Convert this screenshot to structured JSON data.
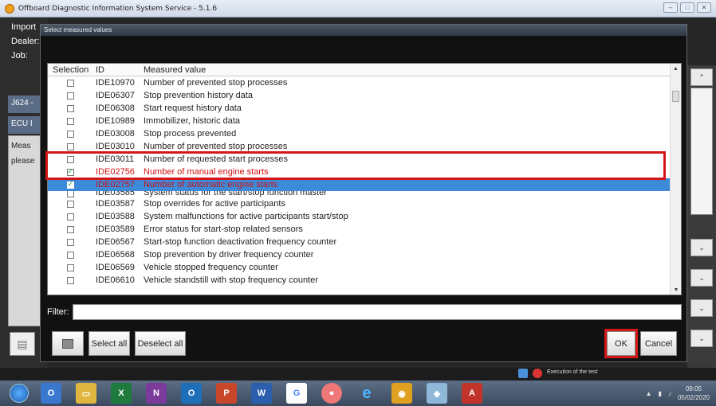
{
  "window": {
    "title": "Offboard Diagnostic Information System Service - 5.1.6"
  },
  "background": {
    "labels": [
      "Import",
      "Dealer:",
      "Job:"
    ],
    "tabs": [
      "J624 -",
      "ECU I"
    ],
    "text": [
      "Meas",
      "please"
    ],
    "status_text": "Execution of the test"
  },
  "dialog": {
    "title": "Select measured values",
    "columns": {
      "selection": "Selection",
      "id": "ID",
      "measured_value": "Measured value"
    },
    "rows": [
      {
        "id": "IDE10970",
        "value": "Number of prevented stop processes",
        "checked": false
      },
      {
        "id": "IDE06307",
        "value": "Stop prevention history data",
        "checked": false
      },
      {
        "id": "IDE06308",
        "value": "Start request history data",
        "checked": false
      },
      {
        "id": "IDE10989",
        "value": "Immobilizer, historic data",
        "checked": false
      },
      {
        "id": "IDE03008",
        "value": "Stop process prevented",
        "checked": false
      },
      {
        "id": "IDE03010",
        "value": "Number of prevented stop processes",
        "checked": false
      },
      {
        "id": "IDE03011",
        "value": "Number of requested start processes",
        "checked": false
      },
      {
        "id": "IDE02756",
        "value": "Number of manual engine starts",
        "checked": true
      },
      {
        "id": "IDE02757",
        "value": "Number of automatic engine starts",
        "checked": true
      },
      {
        "id": "IDE03585",
        "value": "System status for the start/stop function master",
        "checked": false
      },
      {
        "id": "IDE03587",
        "value": "Stop overrides for active participants",
        "checked": false
      },
      {
        "id": "IDE03588",
        "value": "System malfunctions for active participants start/stop",
        "checked": false
      },
      {
        "id": "IDE03589",
        "value": "Error status for start-stop related sensors",
        "checked": false
      },
      {
        "id": "IDE06567",
        "value": "Start-stop function deactivation frequency counter",
        "checked": false
      },
      {
        "id": "IDE06568",
        "value": "Stop prevention by driver frequency counter",
        "checked": false
      },
      {
        "id": "IDE06569",
        "value": "Vehicle stopped frequency counter",
        "checked": false
      },
      {
        "id": "IDE06610",
        "value": "Vehicle standstill with stop frequency counter",
        "checked": false
      }
    ],
    "filter": {
      "label": "Filter:",
      "value": ""
    },
    "buttons": {
      "select_all": "Select all",
      "deselect_all": "Deselect all",
      "ok": "OK",
      "cancel": "Cancel"
    }
  },
  "taskbar": {
    "time": "09:05",
    "date": "05/02/2020"
  },
  "colors": {
    "highlight": "#d41616",
    "selected_row": "#3d8ad9",
    "accent_text": "#d01010"
  }
}
